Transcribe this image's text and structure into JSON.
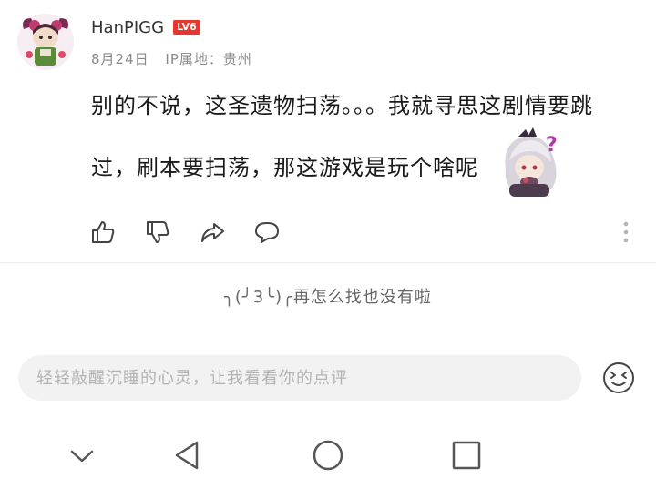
{
  "post": {
    "username": "HanPIGG",
    "level": "LV6",
    "date": "8月24日",
    "ip_location": "IP属地：贵州",
    "content_line1": "别的不说，这圣遗物扫荡。。。我就寻思这剧情要跳",
    "content_line2": "过，刷本要扫荡，那这游戏是玩个啥呢"
  },
  "actions": [
    "thumb-up",
    "thumb-down",
    "share",
    "comment"
  ],
  "comments_empty_text": "╮(╯3╰)╭再怎么找也没有啦",
  "comment_input": {
    "placeholder": "轻轻敲醒沉睡的心灵，让我看看你的点评",
    "value": ""
  },
  "colors": {
    "level_badge": "#e8352e",
    "divider": "#ececec",
    "input_bg": "#f2f2f2"
  }
}
